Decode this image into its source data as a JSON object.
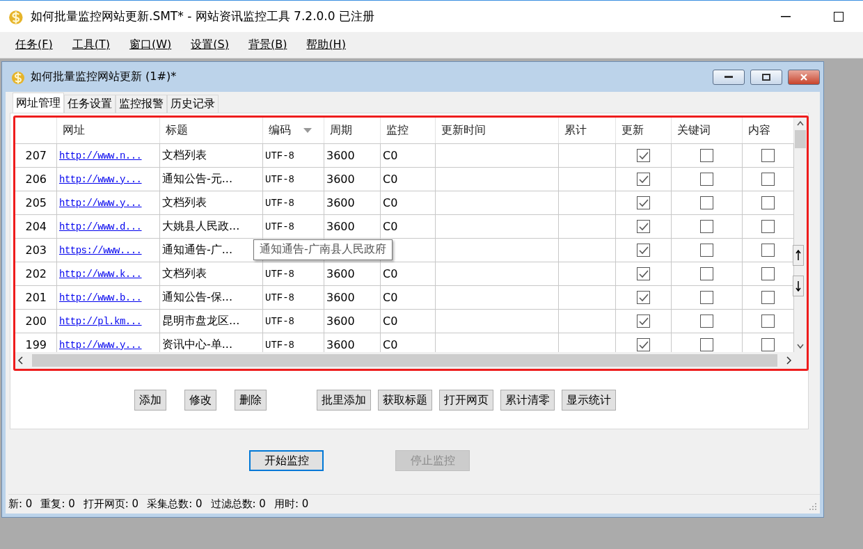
{
  "window": {
    "title": "如何批量监控网站更新.SMT* - 网站资讯监控工具 7.2.0.0  已注册"
  },
  "menu": [
    "任务(F)",
    "工具(T)",
    "窗口(W)",
    "设置(S)",
    "背景(B)",
    "帮助(H)"
  ],
  "child_window": {
    "title": "如何批量监控网站更新  (1#)*"
  },
  "tabs": [
    {
      "label": "网址管理",
      "selected": true
    },
    {
      "label": "任务设置",
      "selected": false
    },
    {
      "label": "监控报警",
      "selected": false
    },
    {
      "label": "历史记录",
      "selected": false
    }
  ],
  "table": {
    "columns": [
      {
        "label": "网址",
        "dropdown": false
      },
      {
        "label": "标题",
        "dropdown": false
      },
      {
        "label": "编码",
        "dropdown": true
      },
      {
        "label": "周期",
        "dropdown": false
      },
      {
        "label": "监控",
        "dropdown": false
      },
      {
        "label": "更新时间",
        "dropdown": false
      },
      {
        "label": "累计",
        "dropdown": false
      },
      {
        "label": "更新",
        "dropdown": false
      },
      {
        "label": "关键词",
        "dropdown": false
      },
      {
        "label": "内容",
        "dropdown": false
      }
    ],
    "rows": [
      {
        "num": "207",
        "url": "http://www.n...",
        "title": "文档列表",
        "encoding": "UTF-8",
        "period": "3600",
        "monitor": "C0",
        "update": true,
        "keyword": false,
        "content": false
      },
      {
        "num": "206",
        "url": "http://www.y...",
        "title": "通知公告-元...",
        "encoding": "UTF-8",
        "period": "3600",
        "monitor": "C0",
        "update": true,
        "keyword": false,
        "content": false
      },
      {
        "num": "205",
        "url": "http://www.y...",
        "title": "文档列表",
        "encoding": "UTF-8",
        "period": "3600",
        "monitor": "C0",
        "update": true,
        "keyword": false,
        "content": false
      },
      {
        "num": "204",
        "url": "http://www.d...",
        "title": "大姚县人民政...",
        "encoding": "UTF-8",
        "period": "3600",
        "monitor": "C0",
        "update": true,
        "keyword": false,
        "content": false
      },
      {
        "num": "203",
        "url": "https://www....",
        "title": "通知通告-广...",
        "update": true,
        "keyword": false,
        "content": false
      },
      {
        "num": "202",
        "url": "http://www.k...",
        "title": "文档列表",
        "encoding": "UTF-8",
        "period": "3600",
        "monitor": "C0",
        "update": true,
        "keyword": false,
        "content": false
      },
      {
        "num": "201",
        "url": "http://www.b...",
        "title": "通知公告-保...",
        "encoding": "UTF-8",
        "period": "3600",
        "monitor": "C0",
        "update": true,
        "keyword": false,
        "content": false
      },
      {
        "num": "200",
        "url": "http://pl.km...",
        "title": "昆明市盘龙区...",
        "encoding": "UTF-8",
        "period": "3600",
        "monitor": "C0",
        "update": true,
        "keyword": false,
        "content": false
      },
      {
        "num": "199",
        "url": "http://www.y...",
        "title": "资讯中心-单...",
        "encoding": "UTF-8",
        "period": "3600",
        "monitor": "C0",
        "update": true,
        "keyword": false,
        "content": false
      }
    ]
  },
  "tooltip": "通知通告-广南县人民政府",
  "action_buttons": [
    "添加",
    "修改",
    "删除",
    "批里添加",
    "获取标题",
    "打开网页",
    "累计清零",
    "显示统计"
  ],
  "control_buttons": [
    {
      "label": "开始监控",
      "disabled": false,
      "focused": true
    },
    {
      "label": "停止监控",
      "disabled": true,
      "focused": false
    }
  ],
  "status_bar": [
    {
      "label": "新:",
      "value": "0"
    },
    {
      "label": "重复:",
      "value": "0"
    },
    {
      "label": "打开网页:",
      "value": "0"
    },
    {
      "label": "采集总数:",
      "value": "0"
    },
    {
      "label": "过滤总数:",
      "value": "0"
    },
    {
      "label": "用时:",
      "value": "0"
    }
  ]
}
